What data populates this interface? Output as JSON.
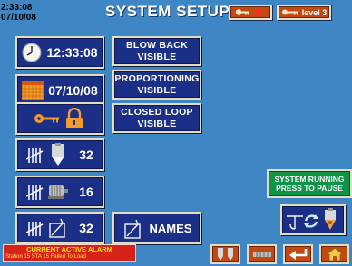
{
  "header": {
    "time": "2:33:08",
    "date": "07/10/08",
    "title": "SYSTEM SETUP",
    "level_label": "level 3"
  },
  "left_buttons": {
    "clock_time": "12:33:08",
    "calendar_date": "07/10/08",
    "counter1_value": "32",
    "counter2_value": "16",
    "counter3_value": "32"
  },
  "right_buttons": {
    "blow_back": [
      "BLOW BACK",
      "VISIBLE"
    ],
    "proportioning": [
      "PROPORTIONING",
      "VISIBLE"
    ],
    "closed_loop": [
      "CLOSED LOOP",
      "VISIBLE"
    ],
    "names": "NAMES"
  },
  "status": {
    "line1": "SYSTEM RUNNING",
    "line2": "PRESS TO PAUSE"
  },
  "alarm": {
    "title": "CURRENT ACTIVE ALARM",
    "detail": "Station 15  STA 15   Failed To Load"
  },
  "colors": {
    "background": "#3f86c4",
    "button_navy": "#1c2f86",
    "button_orange": "#c24a12",
    "status_green": "#0e9447",
    "alarm_red": "#d7221a"
  }
}
